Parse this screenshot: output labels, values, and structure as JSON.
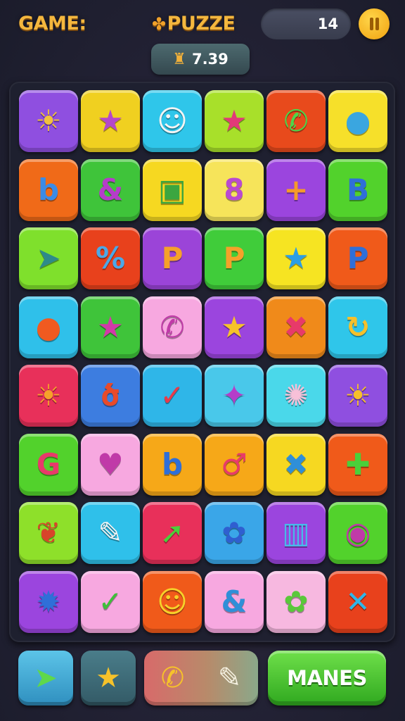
{
  "header": {
    "game_label": "GAME:",
    "puzzle_title": "PUZZE",
    "counter": "14",
    "score": "7.39"
  },
  "board": {
    "tiles": [
      {
        "glyph": "☀",
        "color": "#8f4fe0",
        "fg": "#f2c23b",
        "icon": "sun-icon"
      },
      {
        "glyph": "★",
        "color": "#f0d020",
        "fg": "#b547c9",
        "icon": "star-icon"
      },
      {
        "glyph": "☺",
        "color": "#2fc6ea",
        "fg": "#f4f4f4",
        "icon": "ghost-face-icon"
      },
      {
        "glyph": "★",
        "color": "#a8e02a",
        "fg": "#e23a78",
        "icon": "star-icon"
      },
      {
        "glyph": "✆",
        "color": "#e84a1c",
        "fg": "#4cd64a",
        "icon": "phone-icon"
      },
      {
        "glyph": "●",
        "color": "#f6e02a",
        "fg": "#3aa6e0",
        "icon": "blob-icon"
      },
      {
        "glyph": "b",
        "color": "#f06a18",
        "fg": "#3b8be6",
        "icon": "letter-b-icon"
      },
      {
        "glyph": "&",
        "color": "#3fc43a",
        "fg": "#b53dc9",
        "icon": "ampersand-icon"
      },
      {
        "glyph": "▣",
        "color": "#f6d821",
        "fg": "#3ba640",
        "icon": "trash-icon"
      },
      {
        "glyph": "8",
        "color": "#f6e45a",
        "fg": "#b94ad0",
        "icon": "number-8-icon"
      },
      {
        "glyph": "+",
        "color": "#9b45de",
        "fg": "#f59a2a",
        "icon": "cross-icon"
      },
      {
        "glyph": "B",
        "color": "#52d22c",
        "fg": "#2f6fd8",
        "icon": "letter-b-icon"
      },
      {
        "glyph": "➤",
        "color": "#7fe02c",
        "fg": "#2e8a8a",
        "icon": "arrow-icon"
      },
      {
        "glyph": "%",
        "color": "#e8411c",
        "fg": "#4ba8e8",
        "icon": "percent-icon"
      },
      {
        "glyph": "P",
        "color": "#9b44d8",
        "fg": "#f5a12a",
        "icon": "letter-p-icon"
      },
      {
        "glyph": "P",
        "color": "#40cc3a",
        "fg": "#f5a12a",
        "icon": "letter-p-icon"
      },
      {
        "glyph": "★",
        "color": "#f6e422",
        "fg": "#2a9ee6",
        "icon": "star-icon"
      },
      {
        "glyph": "P",
        "color": "#f05a1a",
        "fg": "#2f6fd8",
        "icon": "letter-p-icon"
      },
      {
        "glyph": "●",
        "color": "#2fc0ea",
        "fg": "#f05a20",
        "icon": "drop-icon"
      },
      {
        "glyph": "★",
        "color": "#3fc43a",
        "fg": "#d23aa8",
        "icon": "star-icon"
      },
      {
        "glyph": "✆",
        "color": "#f7a8e0",
        "fg": "#c03aa8",
        "icon": "phone-icon"
      },
      {
        "glyph": "★",
        "color": "#9b45de",
        "fg": "#f6c32a",
        "icon": "star-icon"
      },
      {
        "glyph": "✖",
        "color": "#f08a1a",
        "fg": "#e83a6a",
        "icon": "cross-icon"
      },
      {
        "glyph": "↻",
        "color": "#2fc6ea",
        "fg": "#f6c02a",
        "icon": "refresh-icon"
      },
      {
        "glyph": "☀",
        "color": "#e8305a",
        "fg": "#f5a12a",
        "icon": "sun-icon"
      },
      {
        "glyph": "ծ",
        "color": "#3d7de0",
        "fg": "#e84a2a",
        "icon": "knot-icon"
      },
      {
        "glyph": "✓",
        "color": "#2fb6e8",
        "fg": "#e83a4a",
        "icon": "swoosh-icon"
      },
      {
        "glyph": "✦",
        "color": "#49c8ea",
        "fg": "#b53dc9",
        "icon": "sparkle-icon"
      },
      {
        "glyph": "✺",
        "color": "#4ad8ea",
        "fg": "#f7c0d8",
        "icon": "splat-icon"
      },
      {
        "glyph": "☀",
        "color": "#8f4fe0",
        "fg": "#f6c02a",
        "icon": "sun-icon"
      },
      {
        "glyph": "G",
        "color": "#52d22c",
        "fg": "#e83a6a",
        "icon": "letter-g-icon"
      },
      {
        "glyph": "♥",
        "color": "#f7a8e0",
        "fg": "#c03aa8",
        "icon": "heart-icon"
      },
      {
        "glyph": "b",
        "color": "#f6a818",
        "fg": "#2f6fd8",
        "icon": "letter-b-icon"
      },
      {
        "glyph": "♂",
        "color": "#f6a818",
        "fg": "#e83a6a",
        "icon": "key-icon"
      },
      {
        "glyph": "✖",
        "color": "#f6d821",
        "fg": "#2f8fd8",
        "icon": "cross-icon"
      },
      {
        "glyph": "✚",
        "color": "#f05a1a",
        "fg": "#4ad03a",
        "icon": "puzzle-piece-icon"
      },
      {
        "glyph": "❦",
        "color": "#8ee02a",
        "fg": "#d8452a",
        "icon": "leaf-icon"
      },
      {
        "glyph": "✎",
        "color": "#2fc0ea",
        "fg": "#f4f4f4",
        "icon": "brush-icon"
      },
      {
        "glyph": "➚",
        "color": "#e8305a",
        "fg": "#4ad03a",
        "icon": "arrow-icon"
      },
      {
        "glyph": "✿",
        "color": "#3aa6e8",
        "fg": "#2f5fd0",
        "icon": "flower-icon"
      },
      {
        "glyph": "▥",
        "color": "#9b45de",
        "fg": "#4ab8ea",
        "icon": "trash-icon"
      },
      {
        "glyph": "◉",
        "color": "#52d22c",
        "fg": "#c03aa8",
        "icon": "ring-icon"
      },
      {
        "glyph": "✹",
        "color": "#9b45de",
        "fg": "#2f6fd8",
        "icon": "gear-icon"
      },
      {
        "glyph": "✓",
        "color": "#f7a8e0",
        "fg": "#3fbf3a",
        "icon": "check-icon"
      },
      {
        "glyph": "☺",
        "color": "#f05a1a",
        "fg": "#f6d22a",
        "icon": "smiley-icon"
      },
      {
        "glyph": "&",
        "color": "#f7a8e0",
        "fg": "#2f8fd8",
        "icon": "ampersand-icon"
      },
      {
        "glyph": "✿",
        "color": "#f7b8e0",
        "fg": "#5ac83a",
        "icon": "flower-icon"
      },
      {
        "glyph": "✕",
        "color": "#e8411c",
        "fg": "#2fb6e8",
        "icon": "cross-icon"
      }
    ]
  },
  "footer": {
    "tool1_icon": "arrow-icon",
    "tool2_icon": "star-icon",
    "tray_icons": [
      "phone-icon",
      "brush-icon"
    ],
    "action_label": "MANES"
  }
}
